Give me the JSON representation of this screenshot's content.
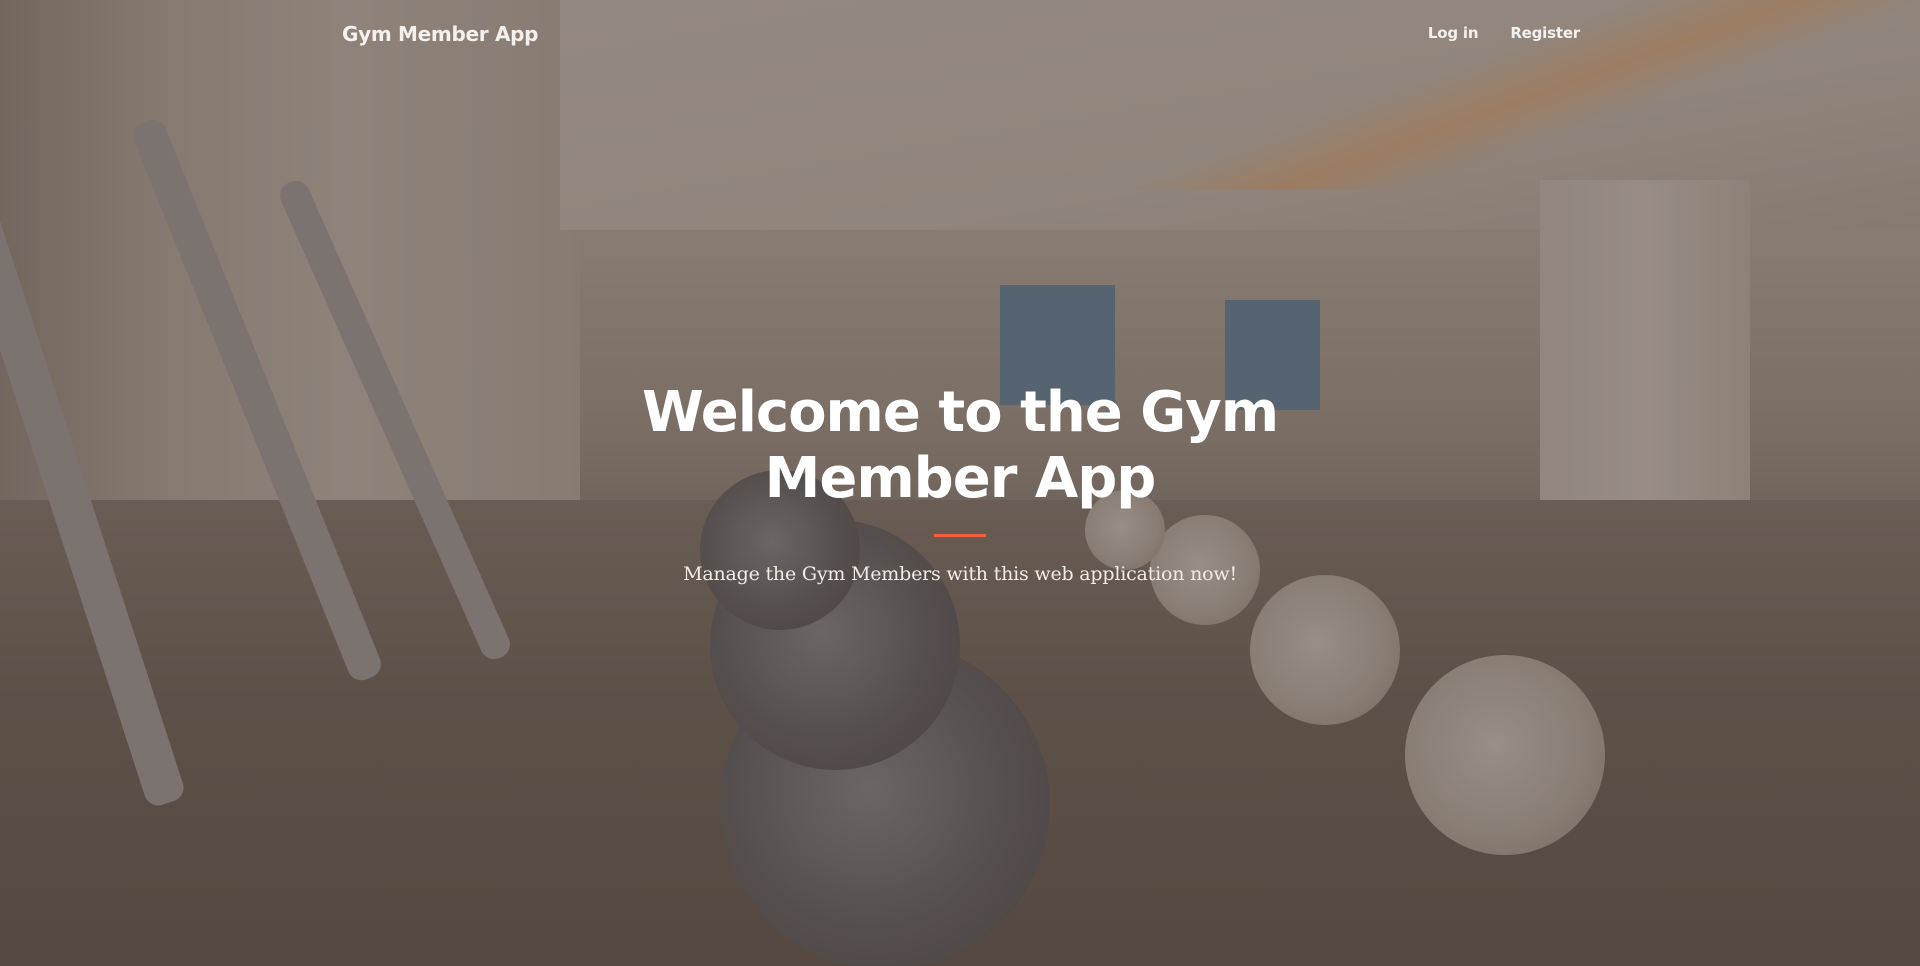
{
  "navbar": {
    "brand": "Gym Member App",
    "links": [
      {
        "label": "Log in"
      },
      {
        "label": "Register"
      }
    ]
  },
  "hero": {
    "title": "Welcome to the Gym Member App",
    "subtitle": "Manage the Gym Members with this web application now!",
    "accent_color": "#f05f40"
  },
  "background": {
    "overlay_color": "#5c4d42"
  }
}
